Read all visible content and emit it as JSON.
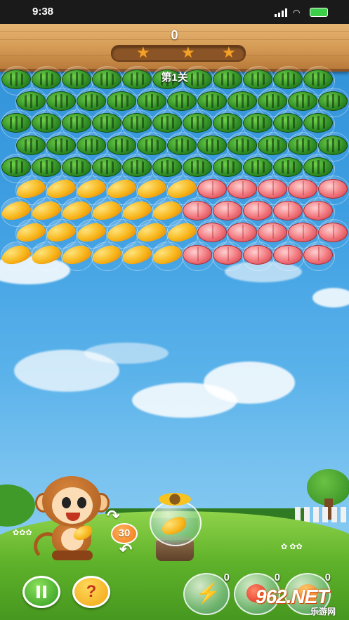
{
  "status_bar": {
    "time": "9:38"
  },
  "header": {
    "score": "0",
    "stars_total": 3,
    "star_glyph": "★"
  },
  "level_label": "第1关",
  "bubble_types": {
    "w": "watermelon",
    "m": "mango",
    "p": "peach"
  },
  "bubble_grid": [
    "wwwwwwwwwww",
    "wwwwwwwwwww",
    "wwwwwwwwwww",
    "wwwwwwwwwww",
    "wwwwwwwwwww",
    "mmmmmmppppp",
    "mmmmmmppppp",
    "mmmmmmppppp",
    "mmmmmmppppp"
  ],
  "launcher": {
    "shots_left": "30",
    "current_bubble": "mango"
  },
  "buttons": {
    "pause_icon": "pause-icon",
    "help_label": "?"
  },
  "powerups": [
    {
      "name": "lightning",
      "count": "0"
    },
    {
      "name": "apple-bomb",
      "count": "0"
    },
    {
      "name": "bomb",
      "count": "0"
    }
  ],
  "watermark": {
    "logo": "962.NET",
    "sub": "乐游网"
  },
  "colors": {
    "sky": "#3f9fe2",
    "wood": "#d49a54",
    "grass": "#5fb22a"
  }
}
